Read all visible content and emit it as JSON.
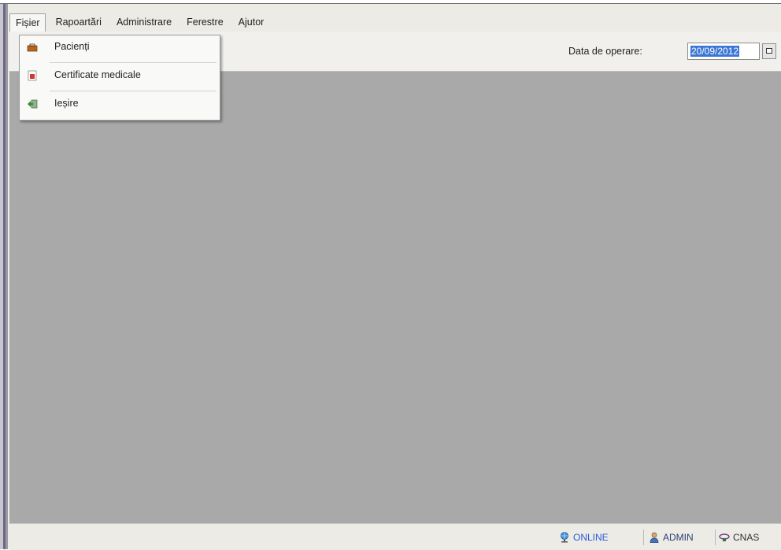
{
  "menubar": {
    "items": [
      {
        "label": "Fișier"
      },
      {
        "label": "Rapoartări"
      },
      {
        "label": "Administrare"
      },
      {
        "label": "Ferestre"
      },
      {
        "label": "Ajutor"
      }
    ]
  },
  "file_menu": {
    "items": [
      {
        "label": "Pacienți",
        "icon": "patients-icon"
      },
      {
        "label": "Certificate medicale",
        "icon": "certificate-icon"
      },
      {
        "label": "Ieșire",
        "icon": "exit-icon"
      }
    ]
  },
  "toolbar": {
    "date_label": "Data de operare:",
    "date_value": "20/09/2012"
  },
  "statusbar": {
    "online": "ONLINE",
    "user": "ADMIN",
    "cnas": "CNAS"
  },
  "colors": {
    "workspace": "#a9a9a9",
    "selection": "#3a76d6",
    "online_text": "#2a5bd7"
  }
}
